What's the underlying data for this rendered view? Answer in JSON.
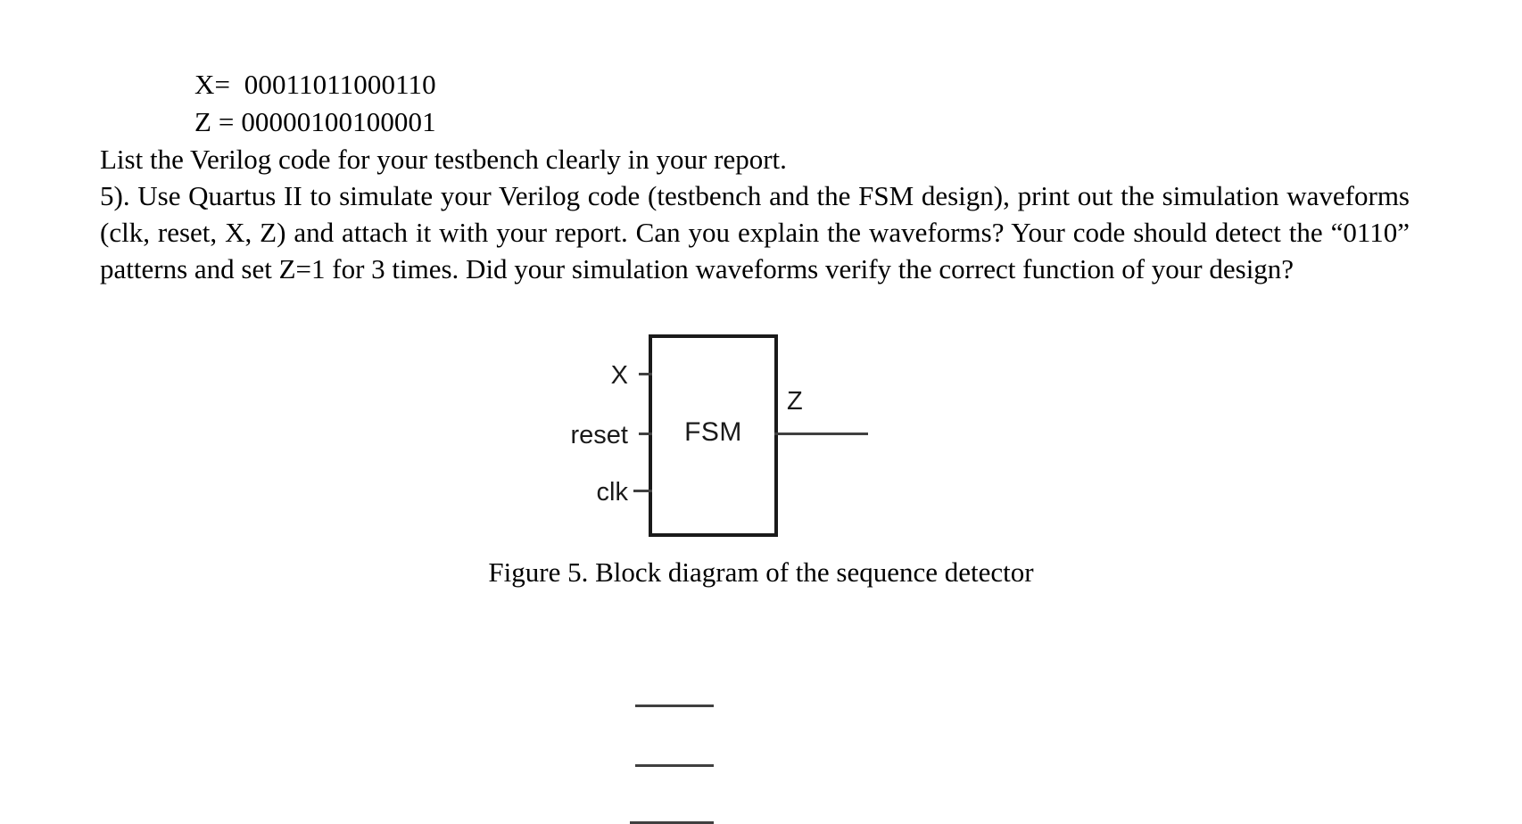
{
  "document": {
    "signals": [
      {
        "name": "X",
        "text": "X=  00011011000110"
      },
      {
        "name": "Z",
        "text": "Z = 00000100100001"
      }
    ],
    "instruction_line": "List the Verilog code for your testbench clearly in your report.",
    "question_paragraph": "5). Use Quartus II to simulate your Verilog code (testbench and the FSM design), print out the simulation waveforms (clk, reset, X, Z) and attach it with your report. Can you explain the waveforms? Your code should detect the “0110” patterns and set Z=1 for 3 times. Did your simulation waveforms verify the correct function of your design?"
  },
  "figure": {
    "block_label": "FSM",
    "inputs": [
      {
        "label": "X"
      },
      {
        "label": "reset"
      },
      {
        "label": "clk"
      }
    ],
    "outputs": [
      {
        "label": "Z"
      }
    ],
    "caption": "Figure 5. Block diagram of the sequence detector"
  },
  "colors": {
    "text": "#000000",
    "box_border": "#1a1a1a",
    "wire": "#404040",
    "background": "#ffffff"
  }
}
